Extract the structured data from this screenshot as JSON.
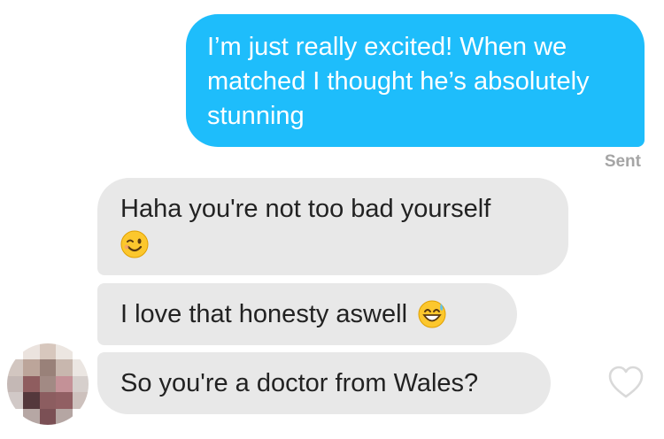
{
  "messages": {
    "outgoing": {
      "text": "I’m just really excited! When we matched I thought he’s absolutely stunning",
      "status": "Sent"
    },
    "incoming": [
      {
        "text": "Haha you're not too bad yourself",
        "emoji": "winking-face-icon"
      },
      {
        "text": "I love that honesty aswell",
        "emoji": "grinning-face-with-sweat-icon"
      },
      {
        "text": "So you're a doctor from Wales?"
      }
    ]
  },
  "colors": {
    "outgoing_bubble": "#1ebdfb",
    "incoming_bubble": "#e8e8e8",
    "status_text": "#a5a5a5"
  },
  "icons": {
    "avatar": "pixelated-avatar",
    "like": "heart-outline-icon"
  }
}
